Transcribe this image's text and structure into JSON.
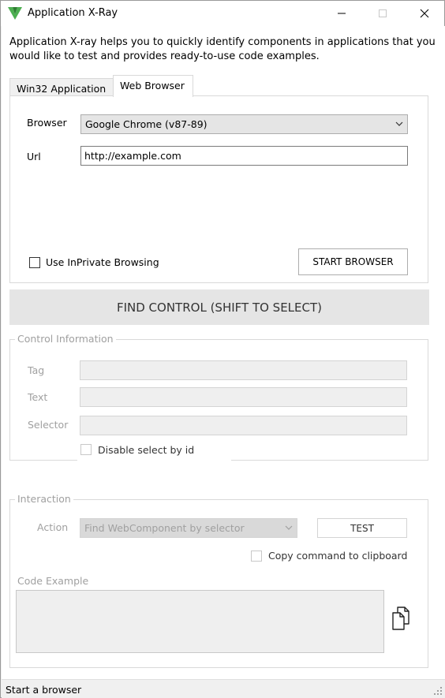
{
  "window": {
    "title": "Application X-Ray",
    "brand_color": "#4caf50",
    "icons": {
      "minimize": "minimize-icon",
      "maximize": "maximize-icon",
      "close": "close-icon"
    }
  },
  "intro": "Application X-ray helps you to quickly identify components in applications that you would like to test and provides ready-to-use code examples.",
  "tabs": [
    {
      "label": "Win32 Application",
      "active": false
    },
    {
      "label": "Web Browser",
      "active": true
    }
  ],
  "browser_panel": {
    "browser_label": "Browser",
    "browser_value": "Google Chrome (v87-89)",
    "url_label": "Url",
    "url_value": "http://example.com",
    "inprivate_label": "Use InPrivate Browsing",
    "inprivate_checked": false,
    "start_button": "START BROWSER"
  },
  "find_control_button": "FIND CONTROL (SHIFT TO SELECT)",
  "control_info": {
    "title": "Control Information",
    "tag_label": "Tag",
    "tag_value": "",
    "text_label": "Text",
    "text_value": "",
    "selector_label": "Selector",
    "selector_value": "",
    "disable_select_label": "Disable select by id",
    "disable_select_checked": false
  },
  "interaction": {
    "title": "Interaction",
    "action_label": "Action",
    "action_value": "Find WebComponent by selector",
    "test_button": "TEST",
    "copy_clipboard_label": "Copy command to clipboard",
    "copy_clipboard_checked": false,
    "code_example_label": "Code Example",
    "code_example_value": "",
    "copy_icon": "copy-icon"
  },
  "status": {
    "text": "Start a browser"
  }
}
